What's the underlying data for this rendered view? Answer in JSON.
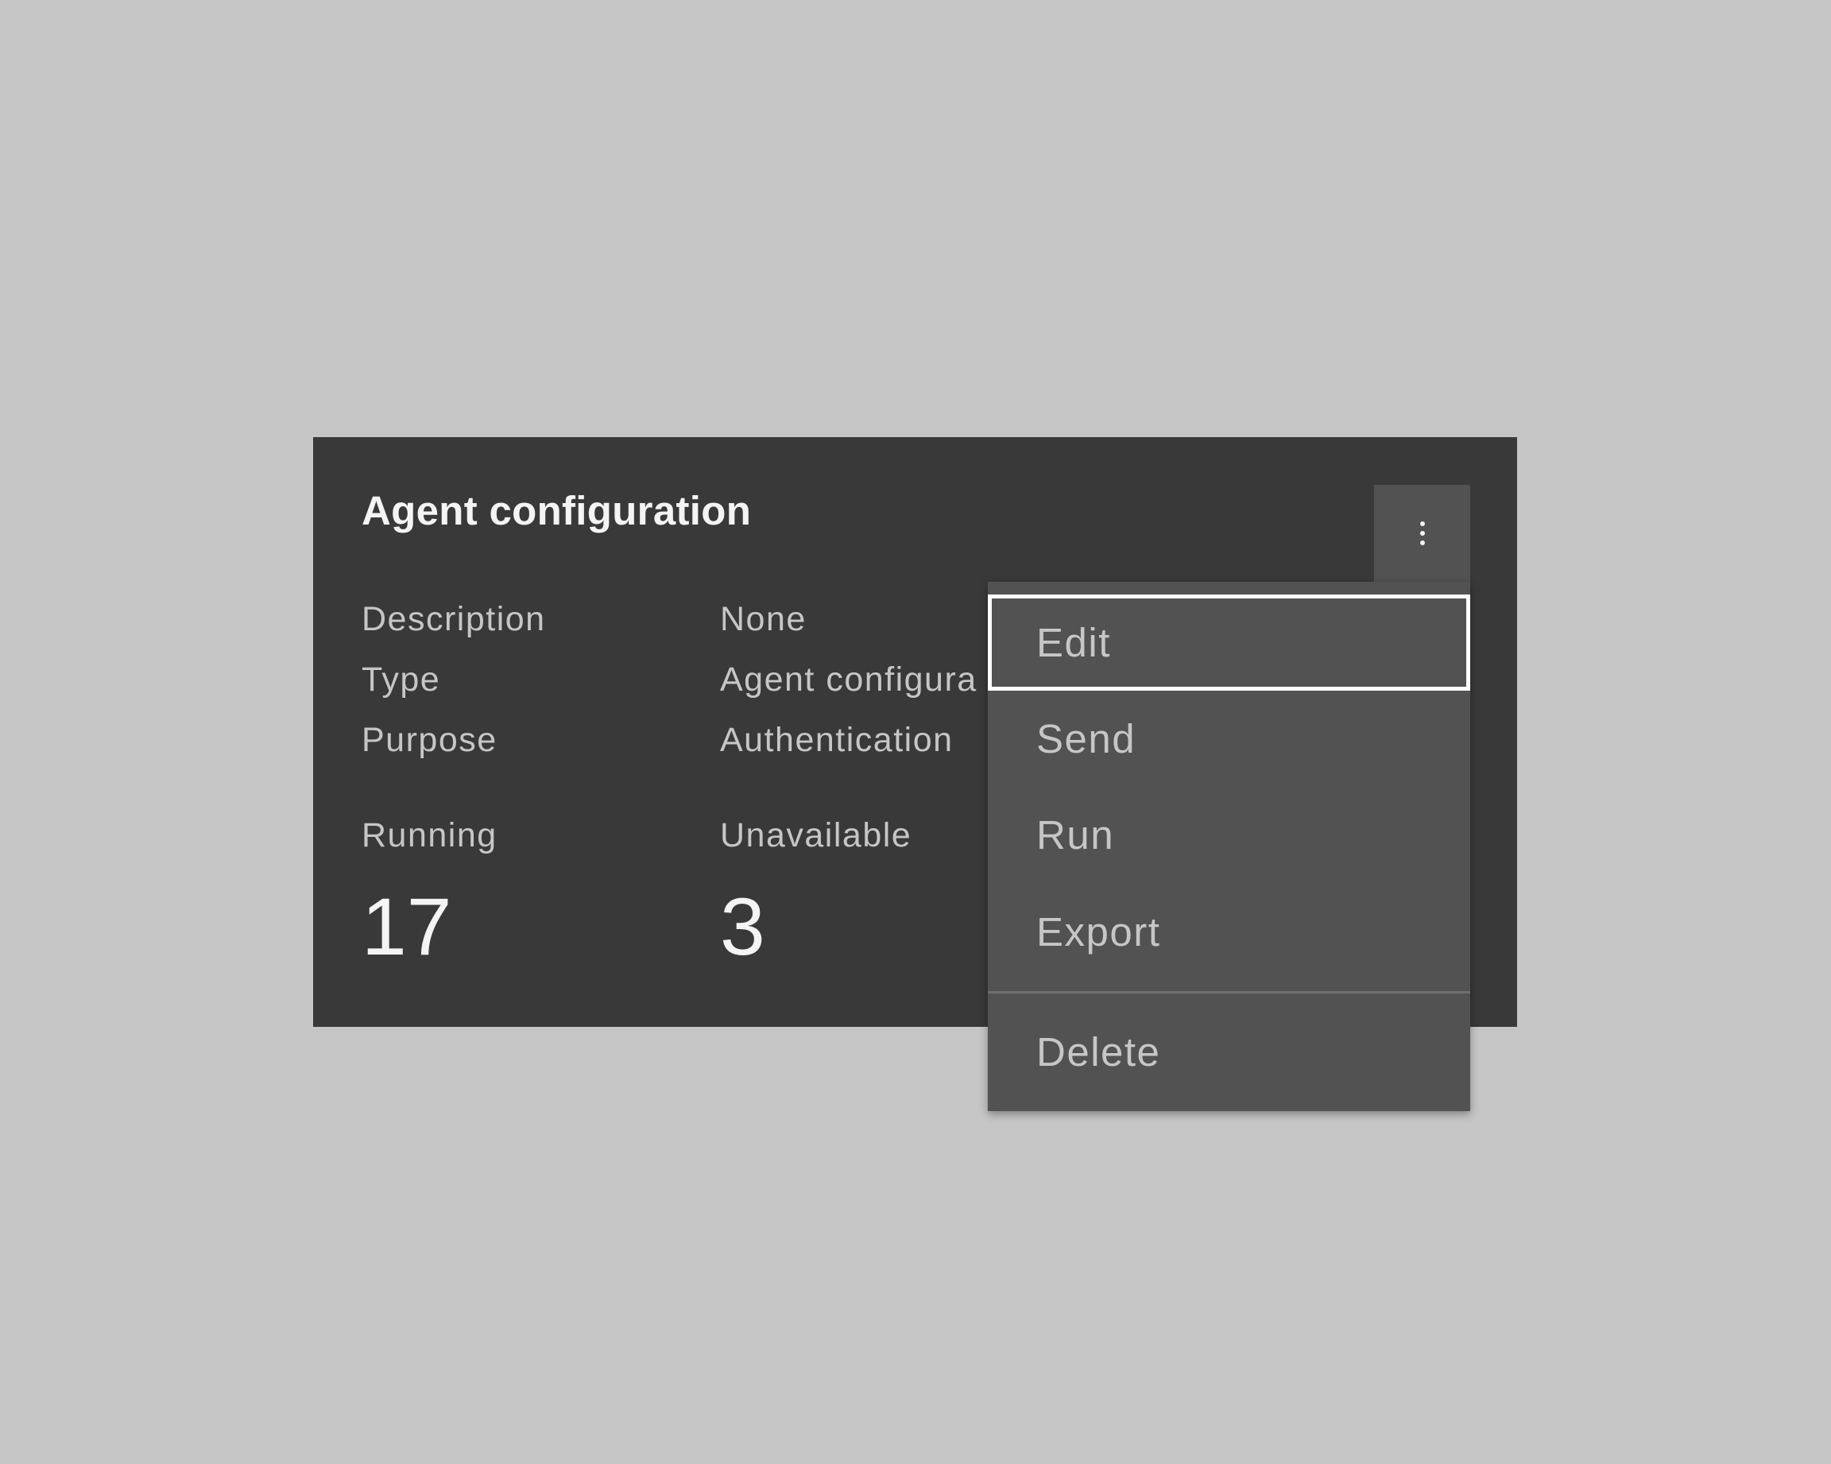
{
  "card": {
    "title": "Agent configuration",
    "properties": [
      {
        "label": "Description",
        "value": "None"
      },
      {
        "label": "Type",
        "value": "Agent configura"
      },
      {
        "label": "Purpose",
        "value": "Authentication"
      }
    ],
    "metrics": [
      {
        "label": "Running",
        "value": "17"
      },
      {
        "label": "Unavailable",
        "value": "3"
      }
    ],
    "overflow_icon": "overflow-menu-vertical-icon"
  },
  "menu": {
    "items": [
      {
        "label": "Edit",
        "focused": true
      },
      {
        "label": "Send"
      },
      {
        "label": "Run"
      },
      {
        "label": "Export"
      },
      {
        "label": "Delete"
      }
    ]
  },
  "colors": {
    "background": "#c6c6c6",
    "card": "#393939",
    "menu": "#525252",
    "text_primary": "#f4f4f4",
    "text_secondary": "#c6c6c6",
    "focus": "#ffffff",
    "divider": "#6f6f6f"
  }
}
